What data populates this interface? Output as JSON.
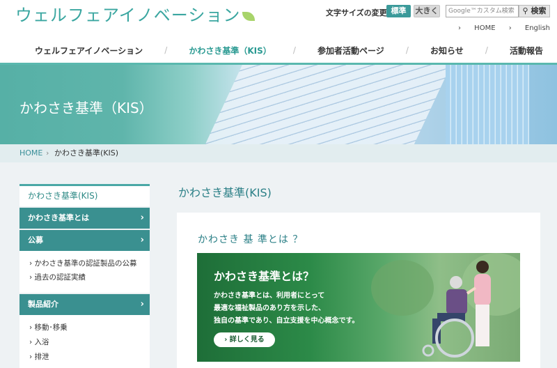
{
  "header": {
    "logo_text": "ウェルフェアイノベーション",
    "font_size_label": "文字サイズの変更",
    "font_size_standard": "標準",
    "font_size_large": "大きく",
    "search_placeholder": "Google™カスタム検索",
    "search_button": "検索",
    "home_link": "HOME",
    "english_link": "English"
  },
  "nav": {
    "items": [
      {
        "label": "ウェルフェアイノベーション"
      },
      {
        "label": "かわさき基準（KIS）"
      },
      {
        "label": "参加者活動ページ"
      },
      {
        "label": "お知らせ"
      },
      {
        "label": "活動報告"
      }
    ],
    "separator": "/"
  },
  "hero": {
    "title": "かわさき基準（KIS）"
  },
  "breadcrumb": {
    "home": "HOME",
    "separator": "›",
    "current": "かわさき基準(KIS)"
  },
  "sidebar": {
    "title": "かわさき基準(KIS)",
    "section1": "かわさき基準とは",
    "section2": "公募",
    "sub2": [
      "› かわさき基準の認証製品の公募",
      "› 過去の認証実績"
    ],
    "section3": "製品紹介",
    "sub3": [
      "› 移動･移乗",
      "› 入浴",
      "› 排泄"
    ],
    "chevron": "›"
  },
  "main": {
    "page_title": "かわさき基準(KIS)",
    "section_title": "かわさき 基 準とは ？",
    "banner_heading": "かわさき基準とは？",
    "banner_lines": [
      "かわさき基準とは、利用者にとって",
      "最適な福祉製品のあり方を示した、",
      "独自の基準であり、自立支援を中心概念です。"
    ],
    "banner_button": "› 詳しく見る"
  }
}
